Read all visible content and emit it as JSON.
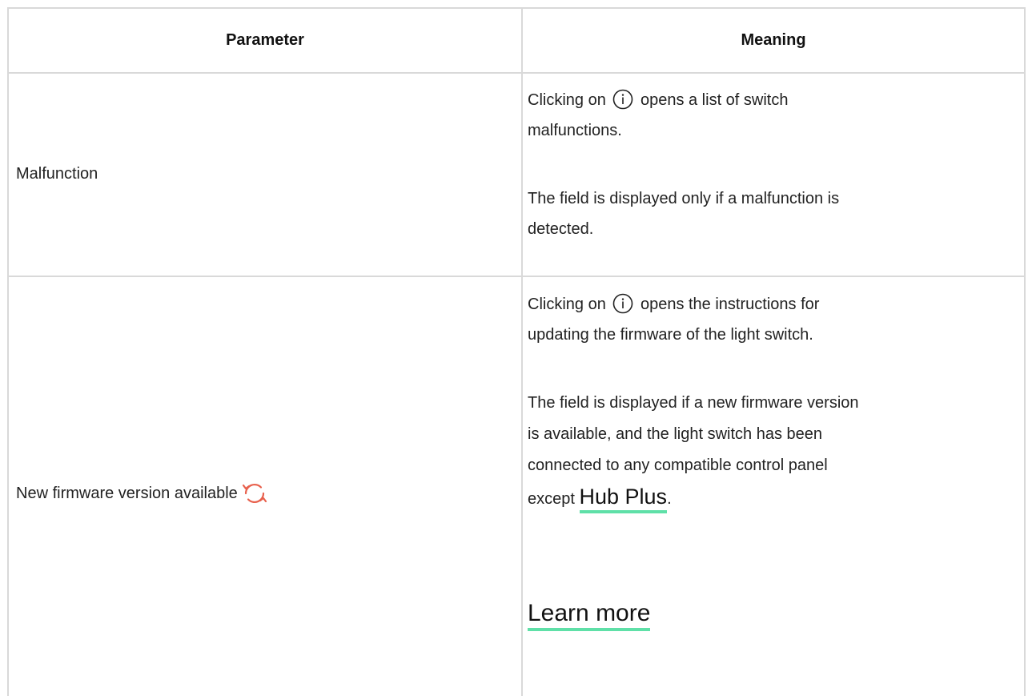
{
  "table": {
    "headers": {
      "parameter": "Parameter",
      "meaning": "Meaning"
    },
    "rows": [
      {
        "parameter": "Malfunction",
        "meaning": {
          "p1_before_icon": "Clicking on",
          "p1_after_icon": "opens a list of switch",
          "p1_line2": "malfunctions.",
          "p2_line1": "The field is displayed only if a malfunction is",
          "p2_line2": "detected."
        }
      },
      {
        "parameter": "New firmware version available",
        "parameter_icon": "refresh-icon",
        "meaning": {
          "p1_before_icon": "Clicking on",
          "p1_after_icon": "opens the instructions for",
          "p1_line2": "updating the firmware of the light switch.",
          "p2_line1": "The field is displayed if a new firmware version",
          "p2_line2": "is available, and the light switch has been",
          "p2_line3": "connected to any compatible control panel",
          "p2_line4_prefix": "except",
          "p2_link": "Hub Plus",
          "p2_line4_suffix": ".",
          "learn_more": "Learn more"
        }
      }
    ]
  },
  "colors": {
    "border": "#d9d9d9",
    "link_underline": "#5fe0a8",
    "refresh_icon": "#e8604c"
  }
}
